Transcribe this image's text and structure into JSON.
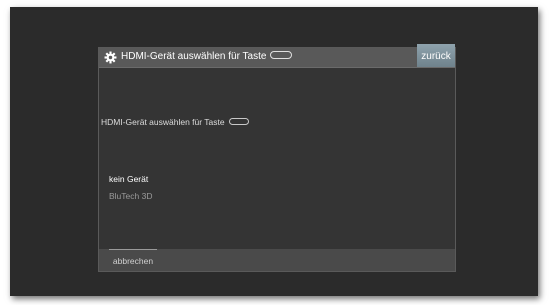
{
  "dialog": {
    "title": "HDMI-Gerät auswählen für Taste",
    "back_label": "zurück",
    "prompt": "HDMI-Gerät auswählen für Taste",
    "options": [
      {
        "label": "kein Gerät",
        "selected": true
      },
      {
        "label": "BluTech 3D",
        "selected": false
      }
    ],
    "cancel_label": "abbrechen",
    "icons": {
      "title": "settings-gear-icon",
      "key": "remote-key-icon"
    }
  }
}
